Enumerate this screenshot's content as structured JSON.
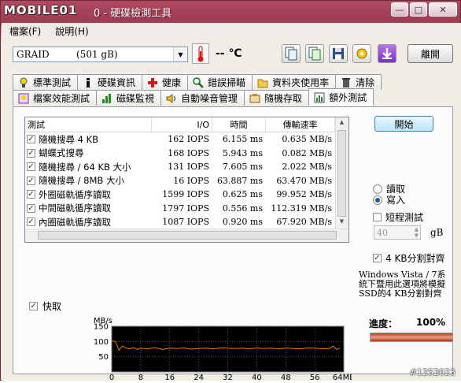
{
  "window": {
    "logo": "MOBILE01",
    "title": "0 - 硬碟檢測工具",
    "buttons": {
      "minimize": "—",
      "maximize": "□",
      "close": "✕"
    }
  },
  "menu": [
    "檔案(F)",
    "說明(H)"
  ],
  "toolbar": {
    "drive": "GRAID",
    "capacity": "(501 gB)",
    "temperature": "-- ℃",
    "exit_label": "離開"
  },
  "tabs_row1": [
    "標準測試",
    "硬碟資訊",
    "健康",
    "錯誤掃瞄",
    "資料夾使用率",
    "清除"
  ],
  "tabs_row2": [
    "檔案效能測試",
    "磁碟監視",
    "自動噪音管理",
    "隨機存取",
    "額外測試"
  ],
  "active_tab": "額外測試",
  "table": {
    "columns": [
      "測試",
      "I/O",
      "時間",
      "傳輸速率"
    ],
    "rows": [
      {
        "name": "隨機搜尋 4 KB",
        "io": "162 IOPS",
        "time": "6.155 ms",
        "rate": "0.635 MB/s"
      },
      {
        "name": "蝴蝶式搜尋",
        "io": "168 IOPS",
        "time": "5.943 ms",
        "rate": "0.082 MB/s"
      },
      {
        "name": "隨機搜尋 / 64 KB 大小",
        "io": "131 IOPS",
        "time": "7.605 ms",
        "rate": "2.022 MB/s"
      },
      {
        "name": "隨機搜尋 / 8MB 大小",
        "io": "16 IOPS",
        "time": "63.887 ms",
        "rate": "63.470 MB/s"
      },
      {
        "name": "外圈磁軌循序讀取",
        "io": "1599 IOPS",
        "time": "0.625 ms",
        "rate": "99.952 MB/s"
      },
      {
        "name": "中間磁軌循序讀取",
        "io": "1797 IOPS",
        "time": "0.556 ms",
        "rate": "112.319 MB/s"
      },
      {
        "name": "內圈磁軌循序讀取",
        "io": "1087 IOPS",
        "time": "0.920 ms",
        "rate": "67.920 MB/s"
      },
      {
        "name": "爆發傳輸率",
        "io": "1637 IOPS",
        "time": "0.611 ms",
        "rate": "102.292 MB/s"
      }
    ]
  },
  "side": {
    "start_label": "開始",
    "read_label": "讀取",
    "write_label": "寫入",
    "mode_selected": "寫入",
    "short_test_label": "短程測試",
    "short_test_checked": false,
    "gb_value": "40",
    "gb_unit": "gB",
    "align_label": "4 KB分割對齊",
    "align_checked": true,
    "note": "Windows Vista / 7系統下暨用此選項將模擬SSD的4 KB分割對齊"
  },
  "quick": {
    "label": "快取",
    "checked": true
  },
  "progress": {
    "label": "進度：",
    "value": "100%",
    "fraction": 1.0
  },
  "chart_data": {
    "type": "line",
    "ylabel": "MB/s",
    "xlabel": "MB",
    "y_ticks": [
      "150",
      "100",
      "50"
    ],
    "x_ticks": [
      "0",
      "8",
      "16",
      "24",
      "32",
      "40",
      "48",
      "56",
      "64MB"
    ],
    "ylim": [
      0,
      150
    ],
    "xlim": [
      0,
      64
    ],
    "series": [
      {
        "color": "#e07a1a",
        "x": [
          0,
          1,
          2,
          3,
          4,
          5,
          6,
          7,
          8,
          10,
          12,
          14,
          16,
          18,
          20,
          22,
          24,
          26,
          28,
          30,
          32,
          34,
          36,
          38,
          40,
          42,
          44,
          46,
          48,
          50,
          52,
          54,
          56,
          58,
          60,
          61,
          62,
          63
        ],
        "y": [
          102,
          100,
          72,
          85,
          78,
          76,
          80,
          74,
          78,
          76,
          80,
          74,
          78,
          77,
          79,
          75,
          77,
          78,
          76,
          79,
          78,
          77,
          78,
          76,
          79,
          77,
          78,
          76,
          78,
          77,
          76,
          79,
          78,
          76,
          77,
          85,
          74,
          78
        ]
      }
    ]
  },
  "watermark": "#1252023"
}
